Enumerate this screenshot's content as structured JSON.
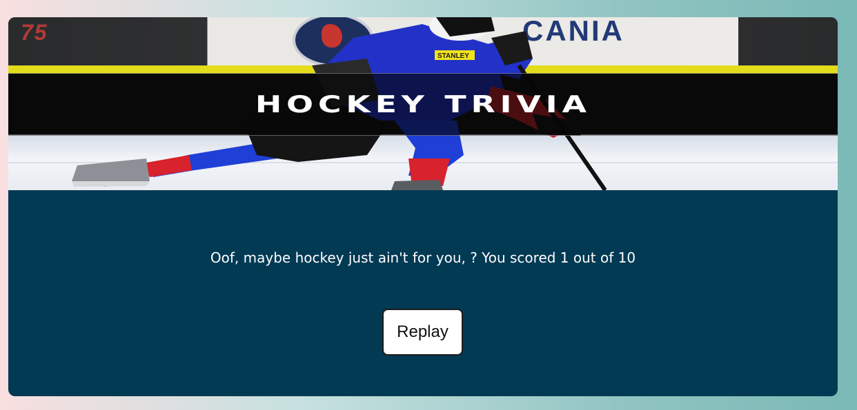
{
  "header": {
    "title": "HOCKEY TRIVIA",
    "hero_image": "hockey-player-skating-photo",
    "ad_left": "75",
    "ad_right": "CANIA",
    "jersey_sponsor": "STANLEY"
  },
  "result": {
    "message": "Oof, maybe hockey just ain't for you, ? You scored 1 out of 10"
  },
  "actions": {
    "replay_label": "Replay"
  },
  "colors": {
    "card_background": "#023a54",
    "button_background": "#ffffff",
    "text": "#ffffff"
  }
}
